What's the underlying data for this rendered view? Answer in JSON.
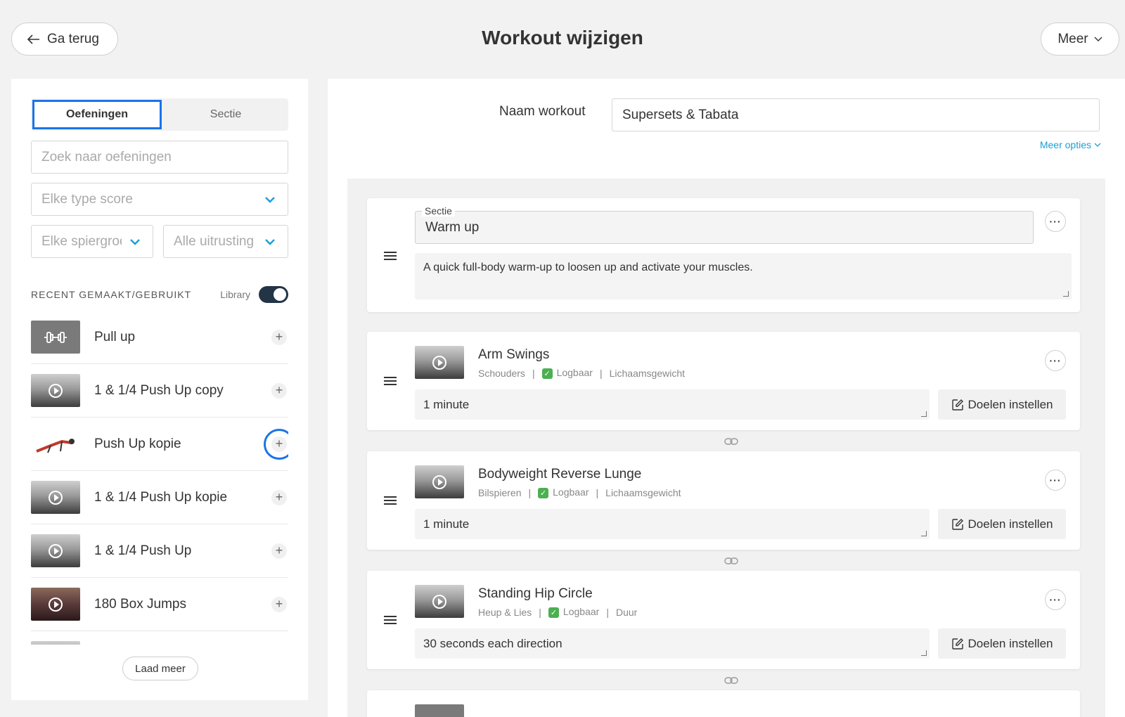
{
  "header": {
    "back_label": "Ga terug",
    "title": "Workout wijzigen",
    "more_label": "Meer"
  },
  "left": {
    "tabs": [
      "Oefeningen",
      "Sectie"
    ],
    "search_placeholder": "Zoek naar oefeningen",
    "filter_score": "Elke type score",
    "filter_muscle": "Elke spiergroep",
    "filter_equipment": "Alle uitrusting",
    "recent_label": "RECENT GEMAAKT/GEBRUIKT",
    "library_label": "Library",
    "library_on": true,
    "exercises": [
      {
        "name": "Pull up"
      },
      {
        "name": "1 & 1/4 Push Up copy"
      },
      {
        "name": "Push Up kopie"
      },
      {
        "name": "1 & 1/4 Push Up kopie"
      },
      {
        "name": "1 & 1/4 Push Up"
      },
      {
        "name": "180 Box Jumps"
      }
    ],
    "load_more": "Laad meer"
  },
  "right": {
    "name_label": "Naam workout",
    "name_value": "Supersets & Tabata",
    "more_options": "Meer opties",
    "section": {
      "label": "Sectie",
      "title": "Warm up",
      "description": "A quick full-body warm-up to loosen up and activate your muscles."
    },
    "exercises": [
      {
        "title": "Arm Swings",
        "muscle": "Schouders",
        "logged": "Logbaar",
        "type": "Lichaamsgewicht",
        "note": "1 minute",
        "goals": "Doelen instellen"
      },
      {
        "title": "Bodyweight Reverse Lunge",
        "muscle": "Bilspieren",
        "logged": "Logbaar",
        "type": "Lichaamsgewicht",
        "note": "1 minute",
        "goals": "Doelen instellen"
      },
      {
        "title": "Standing Hip Circle",
        "muscle": "Heup & Lies",
        "logged": "Logbaar",
        "type": "Duur",
        "note": "30 seconds each direction",
        "goals": "Doelen instellen"
      }
    ]
  },
  "colors": {
    "accent_blue": "#1a73e8",
    "link_blue": "#1aa0d8",
    "toggle_dark": "#243447",
    "check_green": "#4caf50"
  }
}
